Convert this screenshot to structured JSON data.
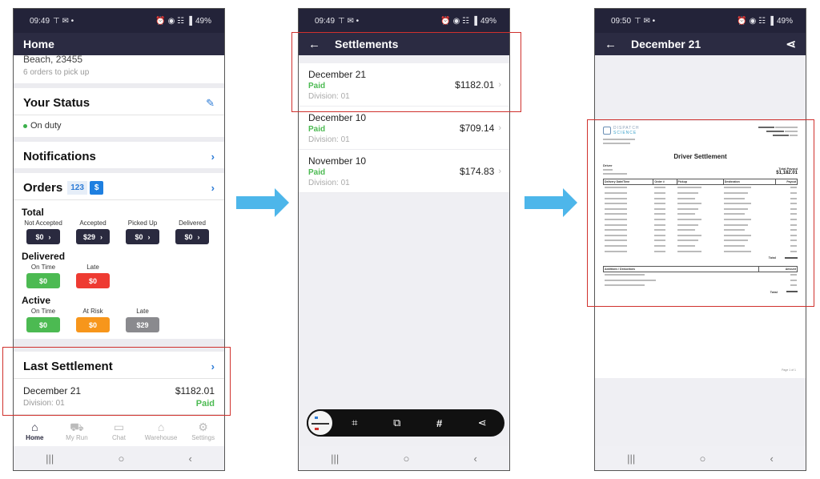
{
  "status_bar": {
    "phone1_time": "09:49",
    "phone2_time": "09:49",
    "phone3_time": "09:50",
    "battery": "49%",
    "notif_icons": "⊤ ✉ •",
    "system_icons": "⏰ ◉ ☷ ▐"
  },
  "home": {
    "title": "Home",
    "address_partial": "Beach, 23455",
    "pickup_note": "6 orders to pick up",
    "your_status": {
      "title": "Your Status",
      "value": "On duty"
    },
    "notifications": {
      "title": "Notifications"
    },
    "orders": {
      "title": "Orders",
      "toggle_count": "123",
      "toggle_dollar": "$",
      "total": {
        "title": "Total",
        "items": [
          {
            "label": "Not Accepted",
            "value": "$0"
          },
          {
            "label": "Accepted",
            "value": "$29"
          },
          {
            "label": "Picked Up",
            "value": "$0"
          },
          {
            "label": "Delivered",
            "value": "$0"
          }
        ]
      },
      "delivered": {
        "title": "Delivered",
        "items": [
          {
            "label": "On Time",
            "value": "$0",
            "color": "#4cba52"
          },
          {
            "label": "Late",
            "value": "$0",
            "color": "#ee3b32"
          }
        ]
      },
      "active": {
        "title": "Active",
        "items": [
          {
            "label": "On Time",
            "value": "$0",
            "color": "#4cba52"
          },
          {
            "label": "At Risk",
            "value": "$0",
            "color": "#f7961b"
          },
          {
            "label": "Late",
            "value": "$29",
            "color": "#8a8a8e"
          }
        ]
      }
    },
    "last_settlement": {
      "title": "Last Settlement",
      "date": "December 21",
      "division": "Division: 01",
      "amount": "$1182.01",
      "status": "Paid"
    },
    "tabs": [
      {
        "label": "Home",
        "icon": "home-icon",
        "active": true
      },
      {
        "label": "My Run",
        "icon": "truck-icon",
        "active": false
      },
      {
        "label": "Chat",
        "icon": "chat-icon",
        "active": false
      },
      {
        "label": "Warehouse",
        "icon": "warehouse-icon",
        "active": false
      },
      {
        "label": "Settings",
        "icon": "settings-icon",
        "active": false
      }
    ]
  },
  "settlements": {
    "title": "Settlements",
    "items": [
      {
        "date": "December 21",
        "status": "Paid",
        "division": "Division: 01",
        "amount": "$1182.01"
      },
      {
        "date": "December 10",
        "status": "Paid",
        "division": "Division: 01",
        "amount": "$709.14"
      },
      {
        "date": "November 10",
        "status": "Paid",
        "division": "Division: 01",
        "amount": "$174.83"
      }
    ],
    "screenshot_toolbar": [
      "scan-icon",
      "crop-edit-icon",
      "hashtag-icon",
      "share-icon"
    ]
  },
  "settlement_detail": {
    "title": "December 21",
    "document": {
      "logo_line1": "DISPATCH",
      "logo_line2": "SCIENCE",
      "heading": "Driver Settlement",
      "driver_label": "Driver",
      "total_payout_label": "Total Payout",
      "total_payout": "$1,182.01",
      "table_headers": [
        "Delivery Date/Time",
        "Order #",
        "Pickup",
        "Destination",
        "Payout"
      ],
      "row_count": 13,
      "total_label": "Total",
      "adjustments_headers": [
        "Additions / Deductions",
        "Amount"
      ],
      "adjustment_count": 3,
      "page_label": "Page 1 of 1"
    }
  },
  "colors": {
    "header_bg": "#2b2b42",
    "accent_blue": "#2c7bd6",
    "paid_green": "#4cba52",
    "highlight_red": "#d0312d",
    "arrow_blue": "#4db6ea"
  }
}
